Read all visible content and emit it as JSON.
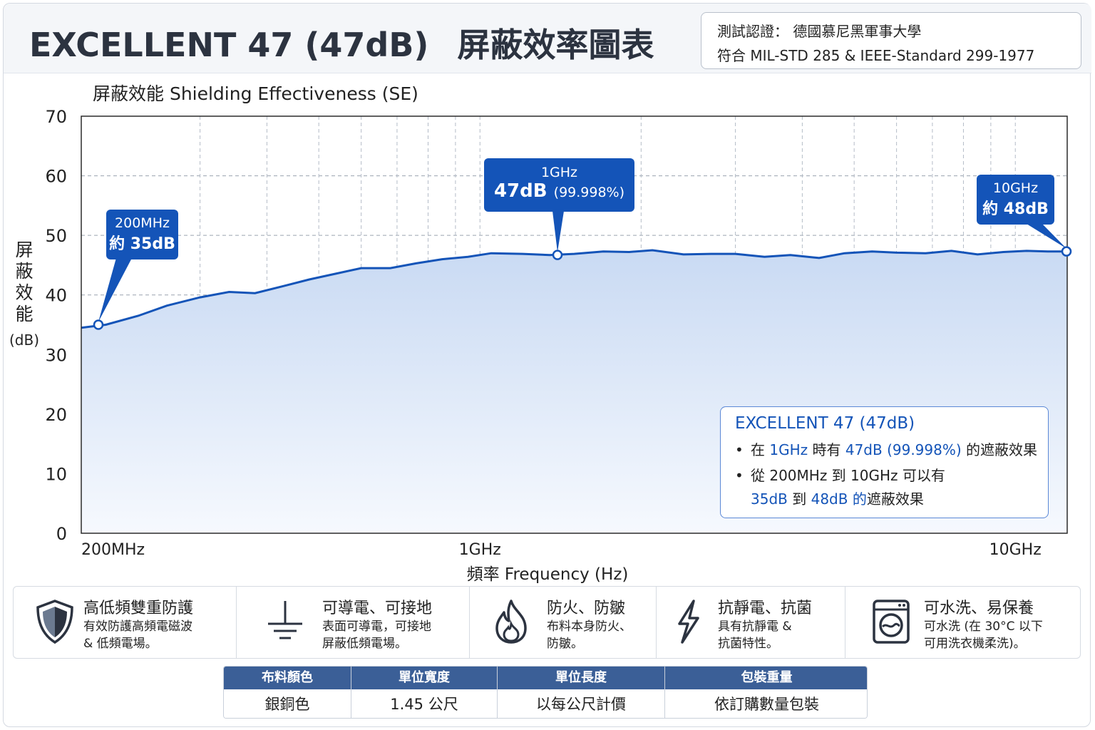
{
  "header": {
    "title_en": "EXCELLENT 47 (47dB)",
    "title_cn": "屏蔽效率圖表",
    "cert_line1": "測試認證： 德國慕尼黑軍事大學",
    "cert_line2": "符合 MIL-STD 285 & IEEE-Standard 299-1977"
  },
  "chart_data": {
    "type": "area",
    "title": "屏蔽效能 Shielding Effectiveness (SE)",
    "ylabel": "屏蔽效能",
    "ylabel_unit": "(dB)",
    "xlabel": "頻率 Frequency (Hz)",
    "xscale": "log",
    "xlim_hz": [
      180000000,
      12500000000
    ],
    "ylim": [
      0,
      70
    ],
    "yticks": [
      0,
      10,
      20,
      30,
      40,
      50,
      60,
      70
    ],
    "xticks": [
      {
        "hz": 200000000,
        "label": "200MHz"
      },
      {
        "hz": 1000000000,
        "label": "1GHz"
      },
      {
        "hz": 10000000000,
        "label": "10GHz"
      }
    ],
    "grid": true,
    "color": "#1454b8",
    "series": [
      {
        "x_hz": [
          180000000,
          200000000,
          230000000,
          260000000,
          300000000,
          340000000,
          380000000,
          430000000,
          480000000,
          540000000,
          600000000,
          680000000,
          760000000,
          850000000,
          950000000,
          1050000000,
          1200000000,
          1350000000,
          1500000000,
          1700000000,
          1900000000,
          2100000000,
          2400000000,
          2700000000,
          3000000000,
          3400000000,
          3800000000,
          4300000000,
          4800000000,
          5400000000,
          6000000000,
          6800000000,
          7600000000,
          8500000000,
          9500000000,
          10500000000,
          11500000000,
          12500000000
        ],
        "y": [
          34.5,
          35.0,
          36.5,
          38.2,
          39.6,
          40.5,
          40.3,
          41.5,
          42.6,
          43.6,
          44.5,
          44.5,
          45.3,
          46.0,
          46.4,
          47.0,
          46.9,
          46.7,
          46.9,
          47.3,
          47.2,
          47.5,
          46.8,
          46.9,
          46.9,
          46.4,
          46.7,
          46.2,
          47.0,
          47.3,
          47.1,
          47.0,
          47.4,
          46.8,
          47.2,
          47.4,
          47.3,
          47.3
        ]
      }
    ],
    "annotations": [
      {
        "hz": 200000000,
        "label1": "200MHz",
        "label2": "約 35dB"
      },
      {
        "hz": 1000000000,
        "label1": "1GHz",
        "label2": "47dB",
        "label2_extra": "(99.998%)"
      },
      {
        "hz": 10000000000,
        "label1": "10GHz",
        "label2": "約 48dB"
      }
    ],
    "legend": {
      "title": "EXCELLENT 47 (47dB)",
      "line1_a": "在 ",
      "line1_b": "1GHz",
      "line1_c": " 時有 ",
      "line1_d": "47dB (99.998%)",
      "line1_e": " 的遮蔽效果",
      "line2": "從 200MHz 到 10GHz 可以有",
      "line3_a": "35dB",
      "line3_b": " 到 ",
      "line3_c": "48dB 的",
      "line3_d": "遮蔽效果"
    }
  },
  "features": [
    {
      "icon": "shield-icon",
      "title": "高低頻雙重防護",
      "desc1": "有效防護高頻電磁波",
      "desc2": "& 低頻電場。"
    },
    {
      "icon": "ground-icon",
      "title": "可導電、可接地",
      "desc1": "表面可導電，可接地",
      "desc2": "屏蔽低頻電場。"
    },
    {
      "icon": "flame-icon",
      "title": "防火、防皺",
      "desc1": "布料本身防火、",
      "desc2": "防皺。"
    },
    {
      "icon": "lightning-icon",
      "title": "抗靜電、抗菌",
      "desc1": "具有抗靜電 &",
      "desc2": "抗菌特性。"
    },
    {
      "icon": "washing-machine-icon",
      "title": "可水洗、易保養",
      "desc1": "可水洗 (在 30°C 以下",
      "desc2": "可用洗衣機柔洗)。"
    }
  ],
  "spec": {
    "headers": [
      "布料顏色",
      "單位寬度",
      "單位長度",
      "包裝重量"
    ],
    "values": [
      "銀銅色",
      "1.45 公尺",
      "以每公尺計價",
      "依訂購數量包裝"
    ]
  }
}
